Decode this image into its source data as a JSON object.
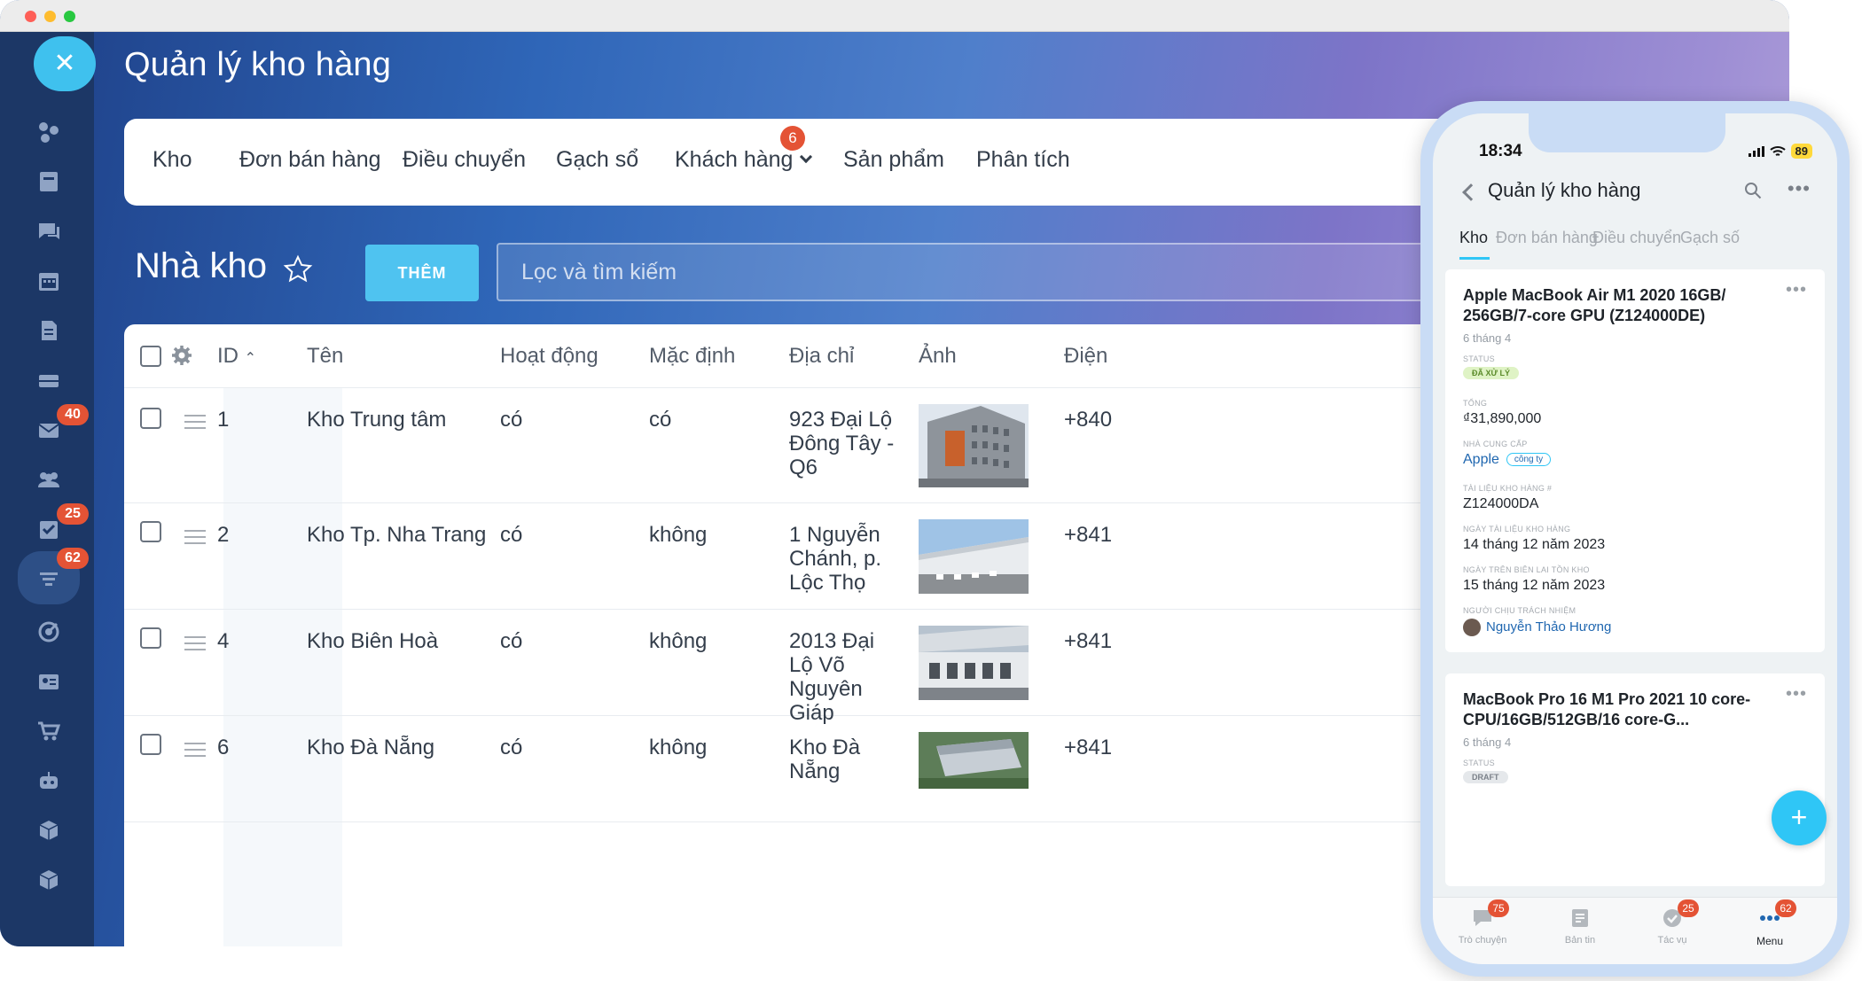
{
  "app": {
    "title": "Quản lý kho hàng",
    "close_symbol": "✕",
    "sidebar": {
      "icons": [
        {
          "name": "crm-icon"
        },
        {
          "name": "calendar-page-icon"
        },
        {
          "name": "chat-icon"
        },
        {
          "name": "calendar-icon"
        },
        {
          "name": "document-icon"
        },
        {
          "name": "inbox-icon"
        },
        {
          "name": "mail-icon",
          "badge": "40"
        },
        {
          "name": "team-icon"
        },
        {
          "name": "tasks-icon",
          "badge": "25"
        },
        {
          "name": "filter-icon",
          "badge": "62"
        },
        {
          "name": "target-icon"
        },
        {
          "name": "contact-card-icon"
        },
        {
          "name": "cart-icon"
        },
        {
          "name": "robot-icon"
        },
        {
          "name": "box-icon"
        },
        {
          "name": "box-2-icon"
        }
      ]
    },
    "nav": [
      {
        "label": "Kho"
      },
      {
        "label": "Đơn bán hàng"
      },
      {
        "label": "Điều chuyển"
      },
      {
        "label": "Gạch sổ"
      },
      {
        "label": "Khách hàng",
        "badge": "6"
      },
      {
        "label": "Sản phẩm"
      },
      {
        "label": "Phân tích"
      }
    ],
    "page": {
      "title": "Nhà kho",
      "add_button": "THÊM",
      "search_placeholder": "Lọc và tìm kiếm"
    },
    "table": {
      "headers": {
        "id": "ID",
        "name": "Tên",
        "active": "Hoạt động",
        "default": "Mặc định",
        "address": "Địa chỉ",
        "image": "Ảnh",
        "phone": "Điện"
      },
      "rows": [
        {
          "id": "1",
          "name": "Kho Trung tâm",
          "active": "có",
          "default": "có",
          "address": "923 Đại Lộ Đông Tây - Q6",
          "phone": "+840"
        },
        {
          "id": "2",
          "name": "Kho Tp. Nha Trang",
          "active": "có",
          "default": "không",
          "address": "1 Nguyễn Chánh, p. Lộc Thọ",
          "phone": "+841"
        },
        {
          "id": "4",
          "name": "Kho Biên Hoà",
          "active": "có",
          "default": "không",
          "address": "2013 Đại Lộ Võ Nguyên Giáp",
          "phone": "+841"
        },
        {
          "id": "6",
          "name": "Kho Đà Nẵng",
          "active": "có",
          "default": "không",
          "address": "Kho Đà Nẵng",
          "phone": "+841"
        }
      ]
    }
  },
  "phone": {
    "time": "18:34",
    "battery": "89",
    "title": "Quản lý kho hàng",
    "tabs": [
      "Kho",
      "Đơn bán hàng",
      "Điều chuyển",
      "Gạch số"
    ],
    "card1": {
      "title": "Apple MacBook Air M1 2020 16GB/ 256GB/7-core GPU (Z124000DE)",
      "date": "6 tháng 4",
      "status_label": "STATUS",
      "status_value": "ĐÃ XỬ LÝ",
      "total_label": "TỔNG",
      "total_value": "₫31,890,000",
      "supplier_label": "NHÀ CUNG CẤP",
      "supplier_value": "Apple",
      "supplier_tag": "công ty",
      "doc_label": "TÀI LIỆU KHO HÀNG #",
      "doc_value": "Z124000DA",
      "doc_date_label": "NGÀY TÀI LIỆU KHO HÀNG",
      "doc_date_value": "14  tháng 12 năm 2023",
      "receipt_date_label": "NGÀY TRÊN BIÊN LAI TỒN KHO",
      "receipt_date_value": "15  tháng 12 năm 2023",
      "responsible_label": "NGƯỜI CHỊU TRÁCH NHIỆM",
      "responsible_value": "Nguyễn Thảo Hương"
    },
    "card2": {
      "title": "MacBook Pro 16 M1 Pro 2021 10 core-CPU/16GB/512GB/16 core-G...",
      "date": "6 tháng 4",
      "status_label": "STATUS",
      "status_value": "DRAFT"
    },
    "fab": "+",
    "bottom_bar": [
      {
        "label": "Trò chuyện",
        "badge": "75",
        "icon": "chat-bubble-icon"
      },
      {
        "label": "Bản tin",
        "badge": "",
        "icon": "newsfeed-icon"
      },
      {
        "label": "Tác vụ",
        "badge": "25",
        "icon": "check-circle-icon"
      },
      {
        "label": "Menu",
        "badge": "62",
        "icon": "dots-icon"
      }
    ]
  }
}
